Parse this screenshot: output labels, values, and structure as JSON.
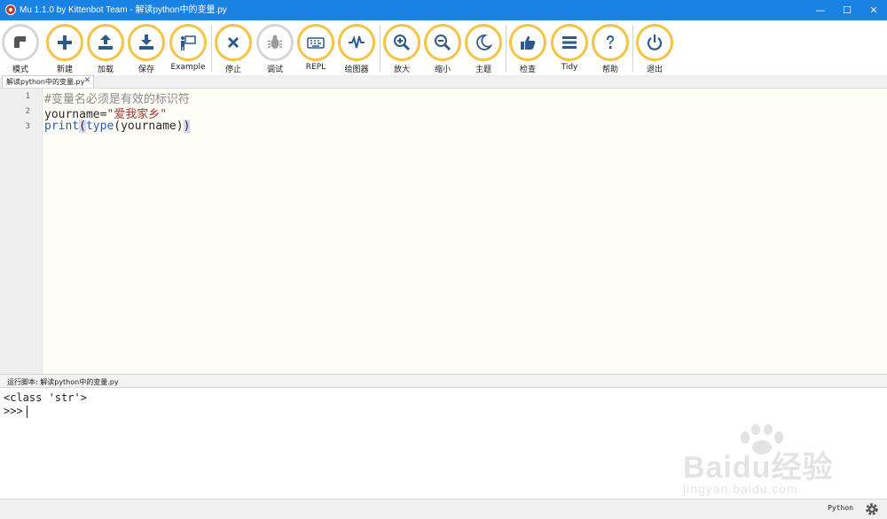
{
  "window": {
    "title": "Mu 1.1.0 by Kittenbot Team - 解读python中的变量.py",
    "controls": {
      "minimize": "—",
      "maximize": "☐",
      "close": "✕"
    }
  },
  "toolbar": {
    "mode": "模式",
    "new": "新建",
    "load": "加载",
    "save": "保存",
    "example": "Example",
    "stop": "停止",
    "debug": "调试",
    "repl": "REPL",
    "plotter": "绘图器",
    "zoom_in": "放大",
    "zoom_out": "缩小",
    "theme": "主题",
    "check": "检查",
    "tidy": "Tidy",
    "help": "帮助",
    "quit": "退出"
  },
  "tab": {
    "label": "解读python中的变量.py",
    "close": "✕"
  },
  "editor": {
    "line_numbers": [
      "1",
      "2",
      "3"
    ],
    "line1_comment": "#变量名必须是有效的标识符",
    "line2_name": "yourname=",
    "line2_string": "\"爱我家乡\"",
    "line3_print": "print",
    "line3_open1": "(",
    "line3_type": "type",
    "line3_open2": "(",
    "line3_arg": "yourname",
    "line3_close2": ")",
    "line3_close1": ")"
  },
  "runner": {
    "title": "运行脚本: 解读python中的变量.py",
    "output_line": "<class 'str'>",
    "prompt": ">>>"
  },
  "statusbar": {
    "mode": "Python"
  },
  "watermark": {
    "text": "Baidu经验",
    "url": "jingyan.baidu.com"
  },
  "colors": {
    "accent": "#f6c344",
    "titlebar": "#1a82e2",
    "icon": "#2c5a8a"
  },
  "icons": {
    "mode": "mode-icon",
    "new": "plus-icon",
    "load": "upload-icon",
    "save": "download-icon",
    "example": "teacher-icon",
    "stop": "x-icon",
    "debug": "bug-icon",
    "repl": "keyboard-icon",
    "plotter": "pulse-icon",
    "zoom_in": "zoom-in-icon",
    "zoom_out": "zoom-out-icon",
    "theme": "moon-icon",
    "check": "thumbs-up-icon",
    "tidy": "lines-icon",
    "help": "question-icon",
    "quit": "power-icon"
  }
}
